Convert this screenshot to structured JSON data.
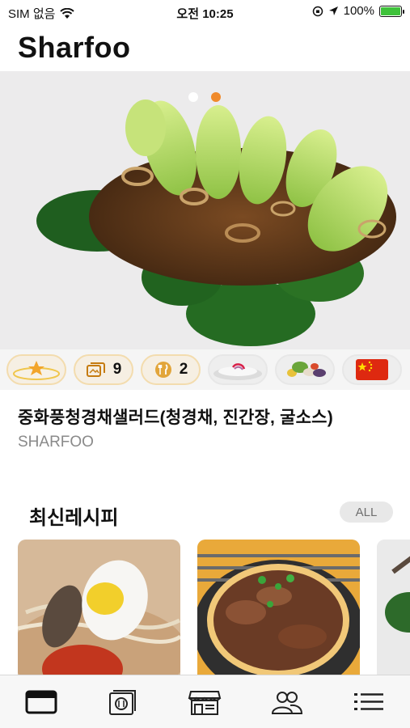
{
  "status": {
    "carrier": "SIM 없음",
    "time": "오전 10:25",
    "battery": "100%"
  },
  "app": {
    "title": "Sharfoo"
  },
  "hero": {
    "slides": 2,
    "active_index": 1
  },
  "chips": [
    {
      "name": "level-chip",
      "icon": "star-plate-icon"
    },
    {
      "name": "steps-chip",
      "icon": "cards-icon",
      "count": "9"
    },
    {
      "name": "servings-chip",
      "icon": "utensils-icon",
      "count": "2"
    },
    {
      "name": "plate-chip",
      "icon": "plate-icon"
    },
    {
      "name": "ingredients-chip",
      "icon": "ingredients-icon"
    },
    {
      "name": "country-chip",
      "icon": "china-flag-icon"
    }
  ],
  "recipe": {
    "title": "중화풍청경채샐러드(청경채, 진간장, 굴소스)",
    "author": "SHARFOO"
  },
  "latest": {
    "title": "최신레시피",
    "all_label": "ALL"
  },
  "tabs": [
    {
      "name": "tab-feed",
      "icon": "card-icon"
    },
    {
      "name": "tab-recipes",
      "icon": "recipe-book-icon"
    },
    {
      "name": "tab-store",
      "icon": "store-icon"
    },
    {
      "name": "tab-community",
      "icon": "people-icon"
    },
    {
      "name": "tab-menu",
      "icon": "list-icon"
    }
  ],
  "colors": {
    "accent": "#f08a2b",
    "chip_border": "#f3dcae"
  }
}
